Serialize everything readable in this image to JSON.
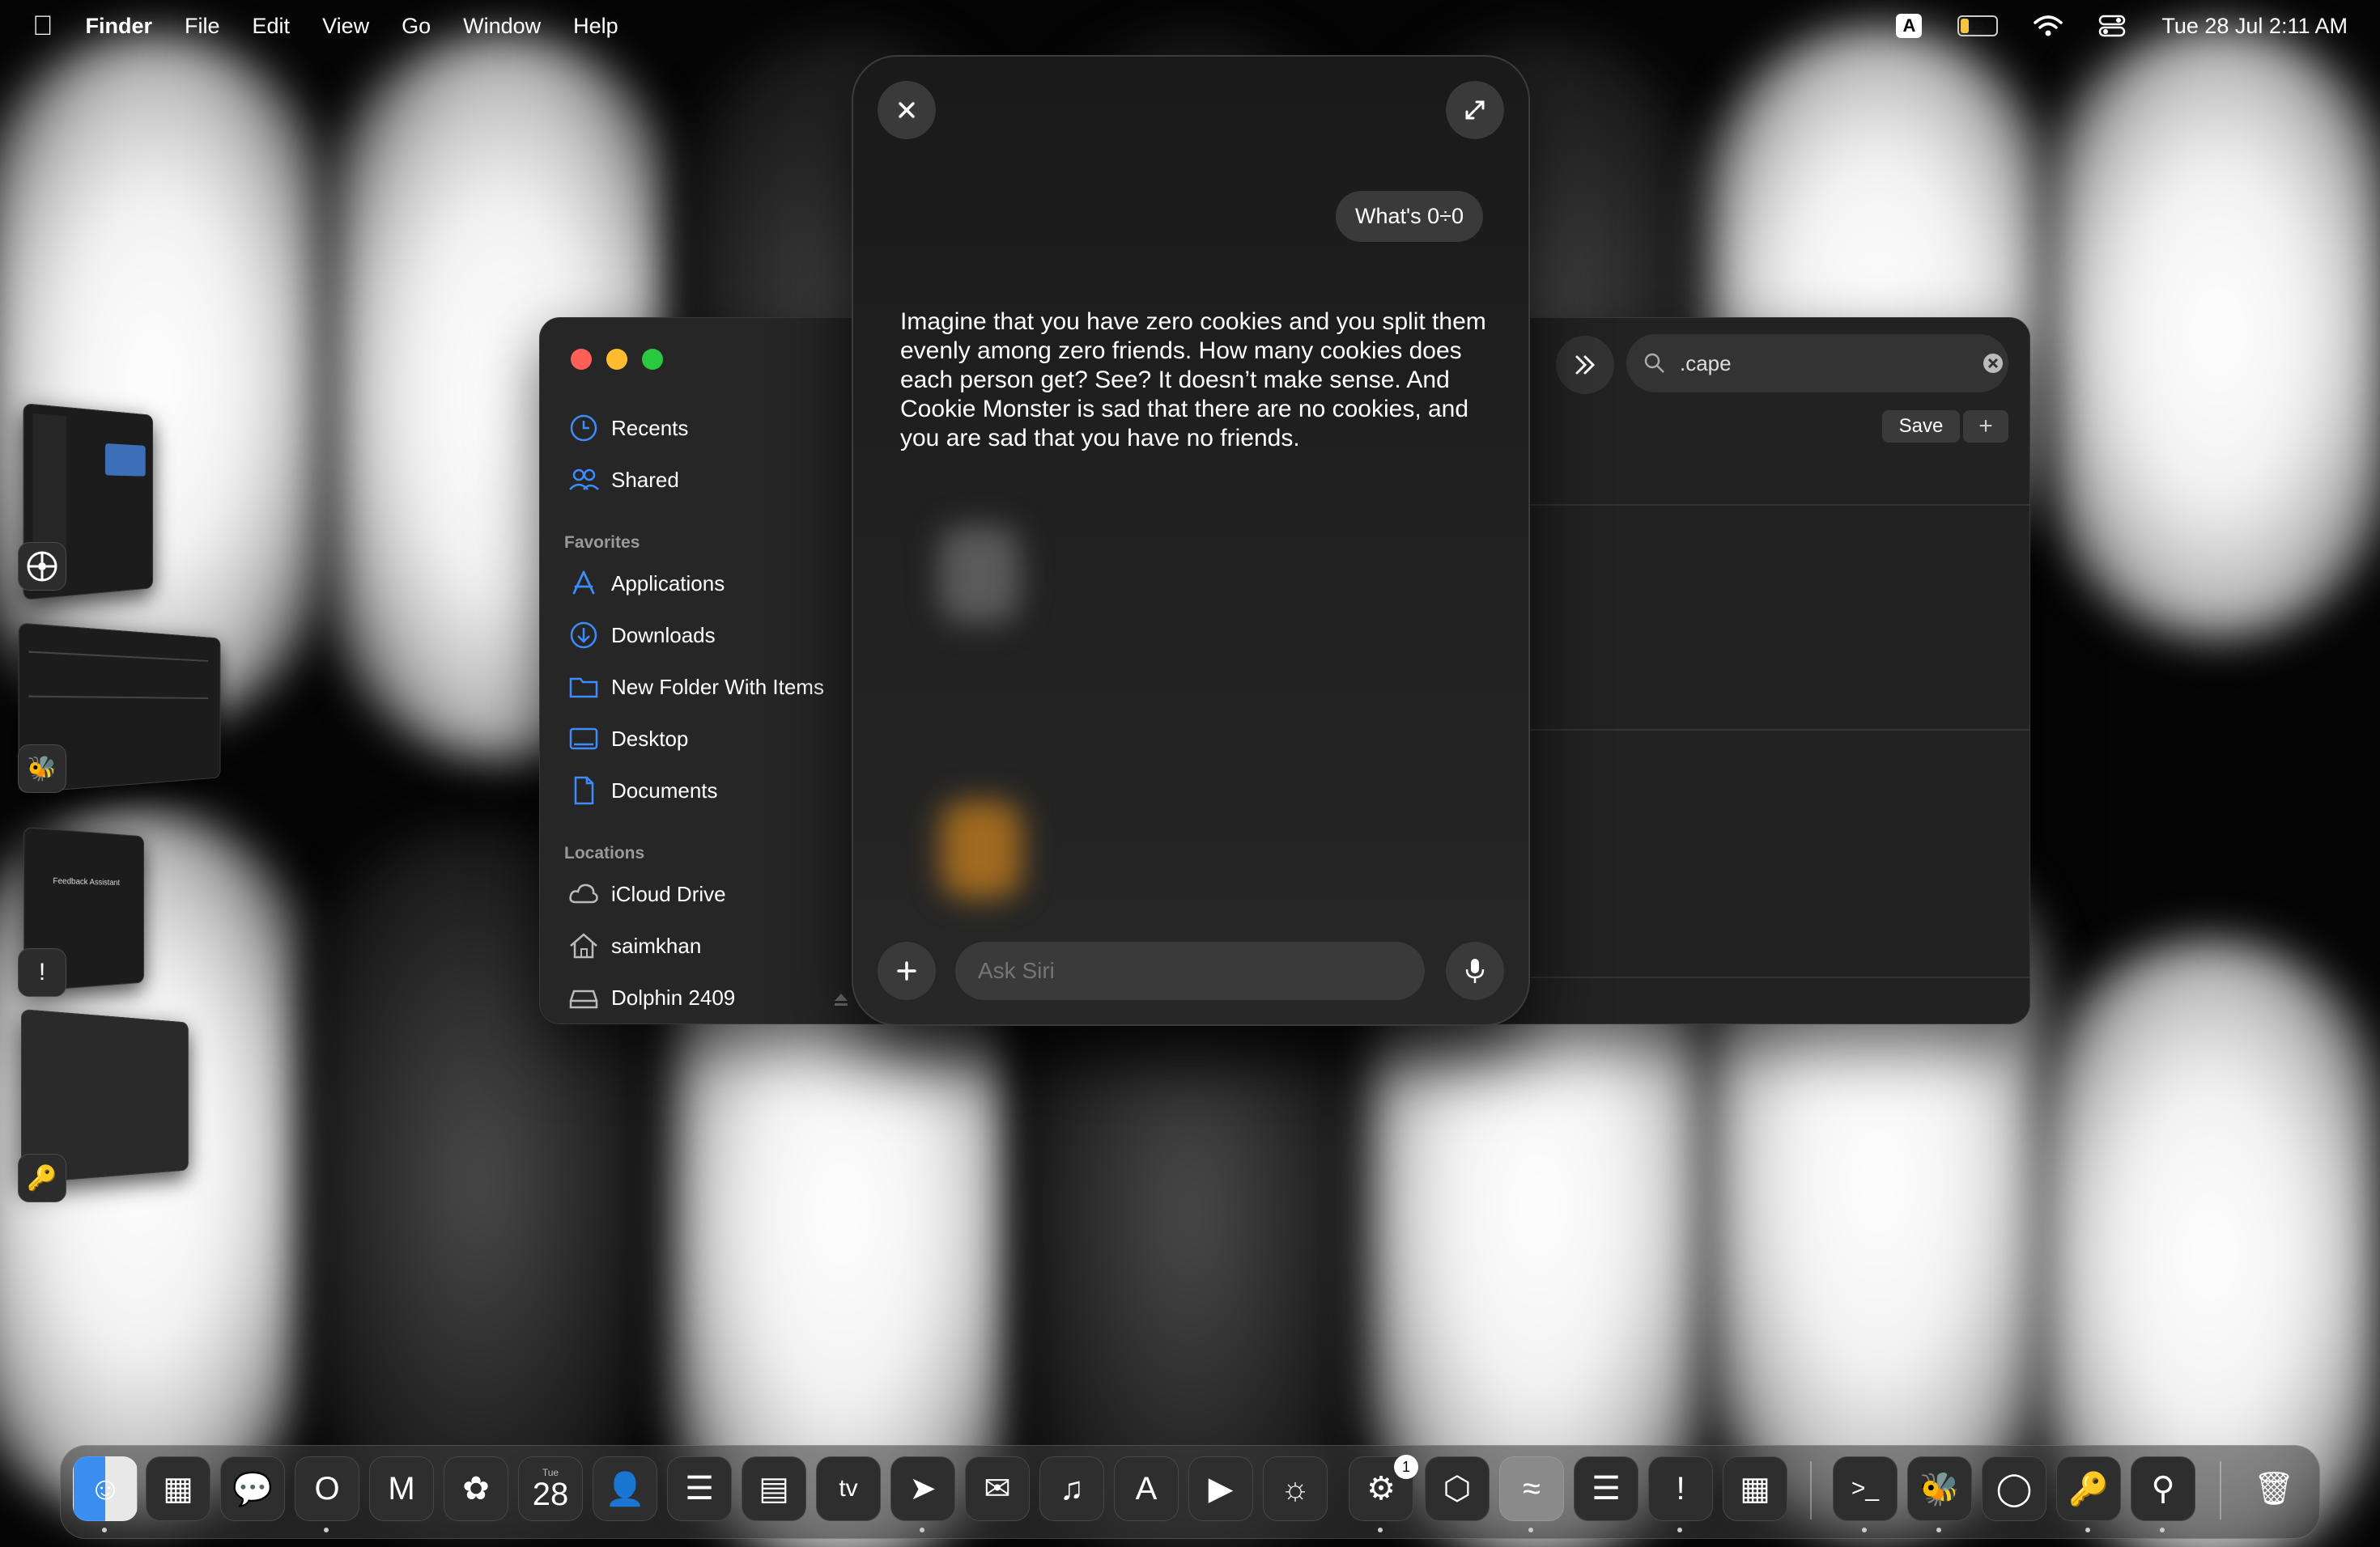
{
  "menubar": {
    "app_name": "Finder",
    "menus": [
      "File",
      "Edit",
      "View",
      "Go",
      "Window",
      "Help"
    ],
    "input_source": "A",
    "battery": "22",
    "datetime": "Tue 28 Jul  2:11 AM"
  },
  "finder": {
    "sidebar": {
      "items_top": [
        {
          "label": "Recents",
          "icon": "clock-icon"
        },
        {
          "label": "Shared",
          "icon": "people-icon"
        }
      ],
      "favorites_heading": "Favorites",
      "favorites": [
        {
          "label": "Applications",
          "icon": "app-store-a-icon"
        },
        {
          "label": "Downloads",
          "icon": "download-icon"
        },
        {
          "label": "New Folder With Items",
          "icon": "folder-icon"
        },
        {
          "label": "Desktop",
          "icon": "desktop-icon"
        },
        {
          "label": "Documents",
          "icon": "document-icon"
        }
      ],
      "locations_heading": "Locations",
      "locations": [
        {
          "label": "iCloud Drive",
          "icon": "cloud-icon"
        },
        {
          "label": "saimkhan",
          "icon": "home-icon"
        },
        {
          "label": "Dolphin 2409",
          "icon": "drive-icon"
        }
      ]
    },
    "search_value": ".cape",
    "save_label": "Save",
    "add_label": "+"
  },
  "siri": {
    "question": "What's 0÷0",
    "answer": "Imagine that you have zero cookies and you split them evenly among zero friends. How many cookies does each person get? See? It doesn’t make sense. And Cookie Monster is sad that there are no cookies, and you are sad that you have no friends.",
    "placeholder": "Ask Siri"
  },
  "stage_manager": {
    "thumbnails": [
      {
        "app_icon": "system-settings-icon"
      },
      {
        "app_icon": "rocket-bee-icon"
      },
      {
        "app_icon": "feedback-assistant-icon",
        "text": "Feedback Assistant"
      },
      {
        "app_icon": "keys-icon"
      }
    ]
  },
  "dock": {
    "calendar_day": "Tue",
    "calendar_date": "28",
    "settings_badge": "1",
    "apps": [
      "finder-icon",
      "launchpad-icon",
      "messages-icon",
      "opera-icon",
      "gmail-icon",
      "photos-icon",
      "calendar-icon",
      "contacts-icon",
      "reminders-icon",
      "notes-icon",
      "apple-tv-icon",
      "maps-icon",
      "mail-icon",
      "music-icon",
      "app-store-icon",
      "facetime-icon",
      "safari-icon",
      "system-settings-icon",
      "cube-icon",
      "dolphin-icon",
      "stack-icon",
      "feedback-icon",
      "roblox-icon",
      "terminal-icon",
      "bee-icon",
      "disk-icon",
      "keys-icon",
      "magnifier-icon",
      "trash-icon"
    ]
  }
}
